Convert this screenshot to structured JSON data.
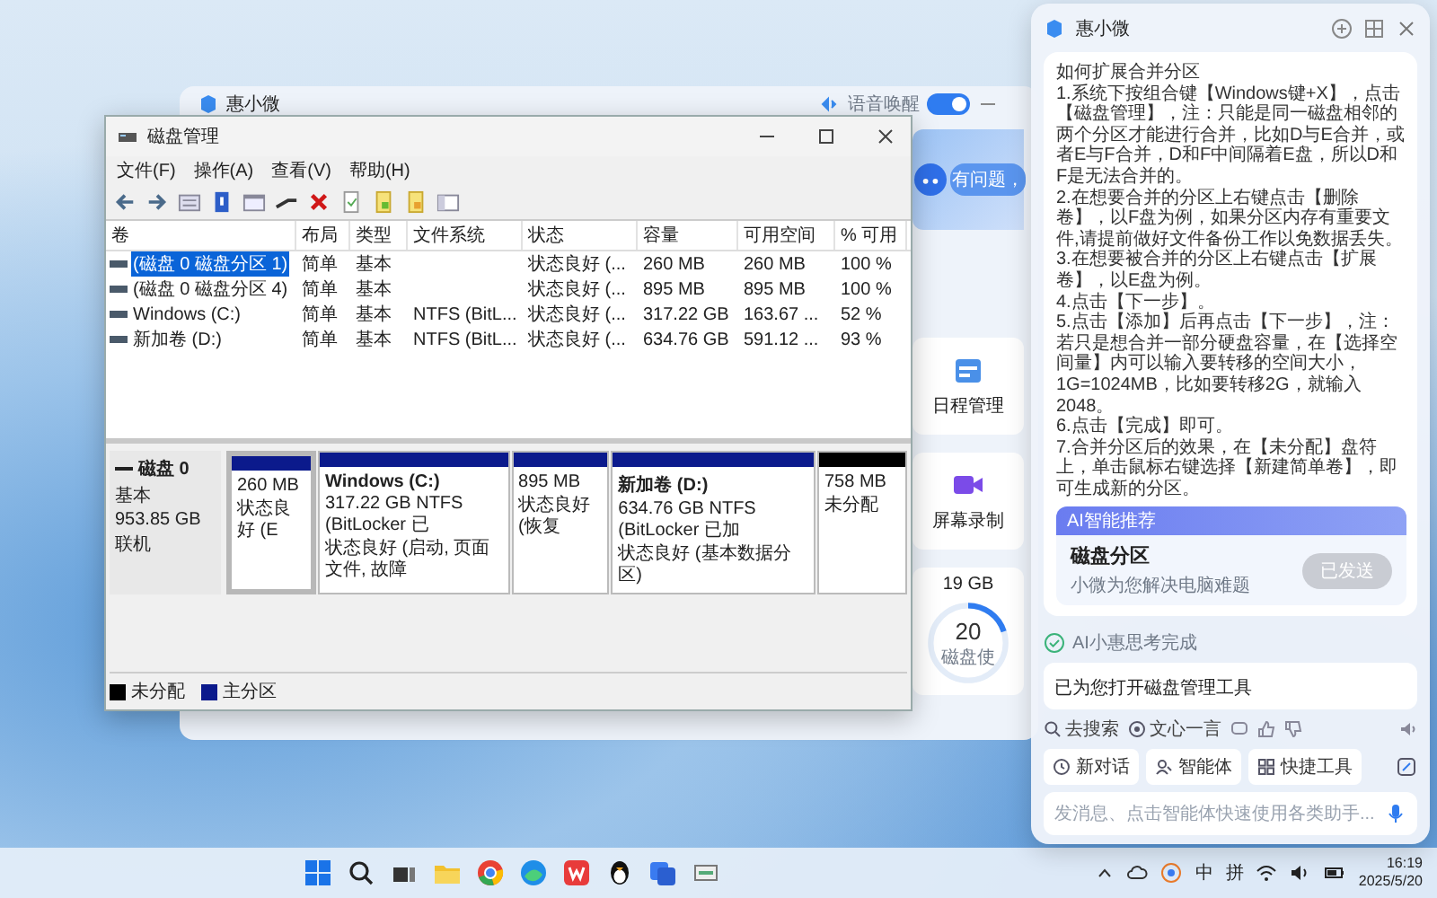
{
  "desktop_app": {
    "title": "惠小微",
    "voice_wake": {
      "label": "语音唤醒",
      "on": true
    },
    "greeting": "有问题，",
    "tiles": [
      {
        "label": "日程管理",
        "kind": "calendar"
      },
      {
        "label": "屏幕录制",
        "kind": "record"
      }
    ],
    "storage": {
      "free": "19 GB",
      "percent": "20",
      "caption": "磁盘使",
      "level": 0.2
    }
  },
  "disk_manager": {
    "title": "磁盘管理",
    "menu": [
      "文件(F)",
      "操作(A)",
      "查看(V)",
      "帮助(H)"
    ],
    "columns": [
      "卷",
      "布局",
      "类型",
      "文件系统",
      "状态",
      "容量",
      "可用空间",
      "% 可用"
    ],
    "volumes": [
      {
        "name": "(磁盘 0 磁盘分区 1)",
        "layout": "简单",
        "type": "基本",
        "status": "状态良好 (...",
        "capacity": "260 MB",
        "free": "260 MB",
        "percent_free": "100 %",
        "selected": true
      },
      {
        "name": "(磁盘 0 磁盘分区 4)",
        "layout": "简单",
        "type": "基本",
        "status": "状态良好 (...",
        "capacity": "895 MB",
        "free": "895 MB",
        "percent_free": "100 %",
        "selected": false
      },
      {
        "name": "Windows (C:)",
        "layout": "简单",
        "type": "基本",
        "file_system": "NTFS (BitL...",
        "status": "状态良好 (...",
        "capacity": "317.22 GB",
        "free": "163.67 ...",
        "percent_free": "52 %",
        "selected": false
      },
      {
        "name": "新加卷 (D:)",
        "layout": "简单",
        "type": "基本",
        "file_system": "NTFS (BitL...",
        "status": "状态良好 (...",
        "capacity": "634.76 GB",
        "free": "591.12 ...",
        "percent_free": "93 %",
        "selected": false
      }
    ],
    "disks": [
      {
        "name": "磁盘 0",
        "type": "基本",
        "size": "953.85 GB",
        "status": "联机",
        "partitions": [
          {
            "kind": "primary",
            "selected": true,
            "lines": [
              "260 MB",
              "状态良好 (E"
            ]
          },
          {
            "kind": "primary",
            "selected": false,
            "name": "Windows (C:)",
            "lines": [
              "317.22 GB NTFS (BitLocker 已",
              "状态良好 (启动, 页面文件, 故障"
            ]
          },
          {
            "kind": "primary",
            "selected": false,
            "lines": [
              "895 MB",
              "状态良好 (恢复"
            ]
          },
          {
            "kind": "primary",
            "selected": false,
            "name": "新加卷 (D:)",
            "lines": [
              "634.76 GB NTFS (BitLocker 已加",
              "状态良好 (基本数据分区)"
            ]
          },
          {
            "kind": "unallocated",
            "selected": false,
            "lines": [
              "758 MB",
              "未分配"
            ]
          }
        ]
      }
    ],
    "legend": [
      {
        "label": "未分配",
        "kind": "unallocated"
      },
      {
        "label": "主分区",
        "kind": "primary"
      }
    ]
  },
  "assistant": {
    "title": "惠小微",
    "answer": {
      "heading": "如何扩展合并分区",
      "steps": [
        "1.系统下按组合键【Windows键+X】，点击【磁盘管理】，注：只能是同一磁盘相邻的两个分区才能进行合并，比如D与E合并，或者E与F合并，D和F中间隔着E盘，所以D和F是无法合并的。",
        "2.在想要合并的分区上右键点击【删除卷】，以F盘为例，如果分区内存有重要文件,请提前做好文件备份工作以免数据丢失。",
        "3.在想要被合并的分区上右键点击【扩展卷】，以E盘为例。",
        "4.点击【下一步】。",
        "5.点击【添加】后再点击【下一步】，注：若只是想合并一部分硬盘容量，在【选择空间量】内可以输入要转移的空间大小，1G=1024MB，比如要转移2G，就输入2048。",
        "6.点击【完成】即可。",
        "7.合并分区后的效果，在【未分配】盘符上，单击鼠标右键选择【新建简单卷】，即可生成新的分区。"
      ]
    },
    "recommend": {
      "tag": "AI智能推荐",
      "title": "磁盘分区",
      "subtitle": "小微为您解决电脑难题",
      "button": {
        "label": "已发送",
        "disabled": true
      }
    },
    "thinking": "AI小惠思考完成",
    "reply": "已为您打开磁盘管理工具",
    "actions": [
      {
        "label": "去搜索",
        "kind": "search"
      },
      {
        "label": "文心一言",
        "kind": "ai"
      }
    ],
    "tools": [
      {
        "label": "新对话",
        "kind": "new"
      },
      {
        "label": "智能体",
        "kind": "agent"
      },
      {
        "label": "快捷工具",
        "kind": "tools"
      }
    ],
    "input": {
      "placeholder": "发消息、点击智能体快速使用各类助手..."
    }
  },
  "taskbar": {
    "ime": [
      "中",
      "拼"
    ],
    "time": "16:19",
    "date": "2025/5/20"
  }
}
